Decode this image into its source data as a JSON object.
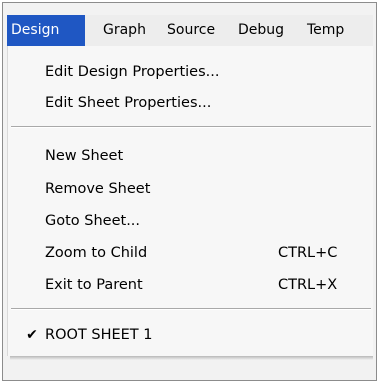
{
  "menubar": {
    "items": [
      {
        "label": "Design"
      },
      {
        "label": "Graph"
      },
      {
        "label": "Source"
      },
      {
        "label": "Debug"
      },
      {
        "label": "Temp"
      }
    ]
  },
  "dropdown": {
    "group1": [
      {
        "label": "Edit Design Properties..."
      },
      {
        "label": "Edit Sheet Properties..."
      }
    ],
    "group2": [
      {
        "label": "New Sheet"
      },
      {
        "label": "Remove Sheet"
      },
      {
        "label": "Goto Sheet..."
      },
      {
        "label": "Zoom to Child",
        "shortcut": "CTRL+C"
      },
      {
        "label": "Exit to Parent",
        "shortcut": "CTRL+X"
      }
    ],
    "group3": [
      {
        "label": "ROOT SHEET 1",
        "checked": true,
        "check_icon": "✔"
      }
    ]
  },
  "colors": {
    "active_menu_bg": "#1f57c3",
    "active_menu_text": "#ffffff",
    "menu_bg": "#f7f7f7"
  }
}
